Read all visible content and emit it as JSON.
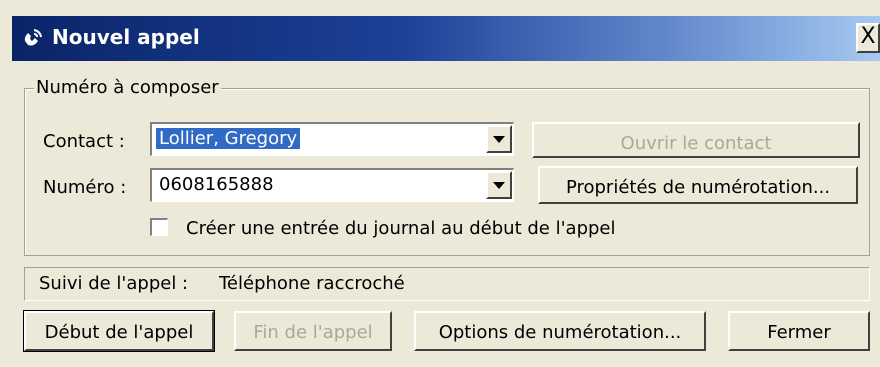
{
  "window": {
    "title": "Nouvel appel",
    "close_label": "X"
  },
  "group": {
    "legend": "Numéro à composer"
  },
  "contact": {
    "label": "Contact :",
    "value": "Lollier, Gregory",
    "open_button": "Ouvrir le contact"
  },
  "numero": {
    "label": "Numéro :",
    "value": "0608165888",
    "dial_props_button": "Propriétés de numérotation..."
  },
  "journal_checkbox": {
    "label": "Créer une entrée du journal au début de l'appel",
    "checked": false
  },
  "status": {
    "label": "Suivi de l'appel :",
    "value": "Téléphone raccroché"
  },
  "buttons": {
    "start": "Début de l'appel",
    "end": "Fin de l'appel",
    "options": "Options de numérotation...",
    "close": "Fermer"
  }
}
